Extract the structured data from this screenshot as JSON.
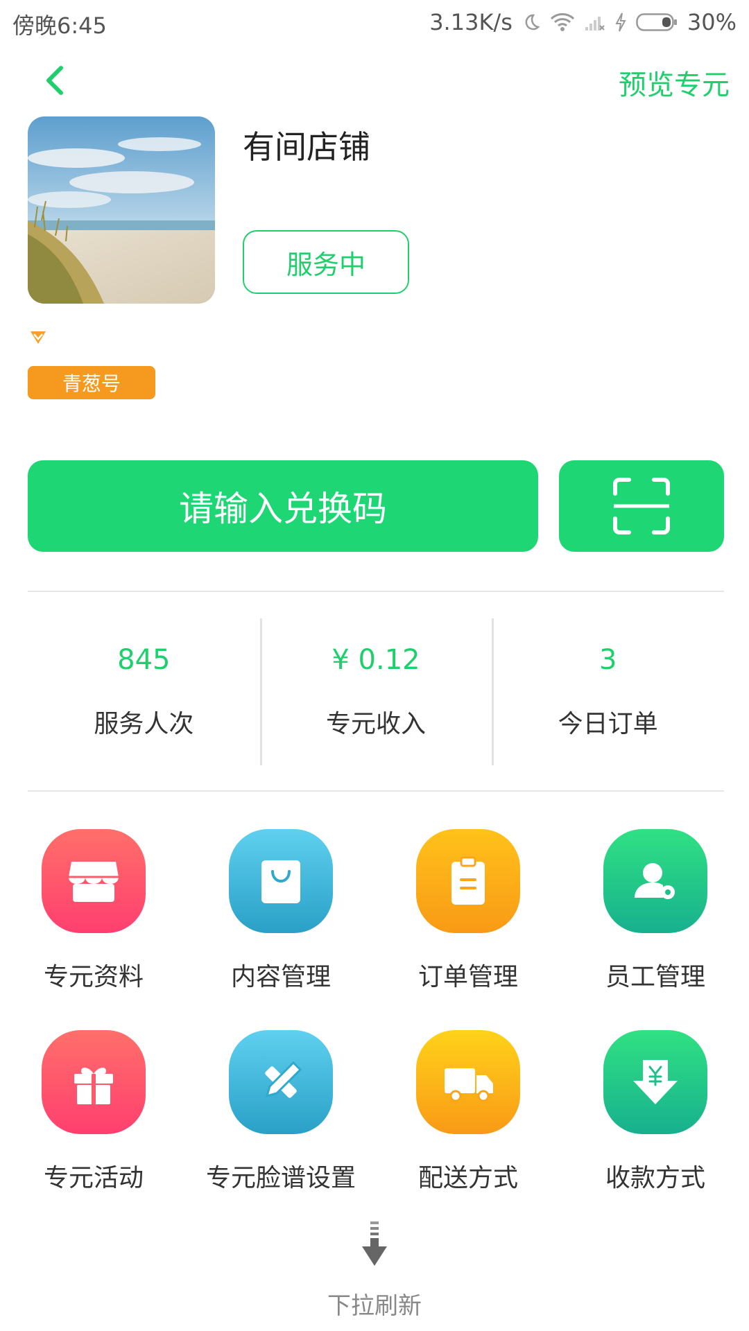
{
  "status_bar": {
    "time": "傍晚6:45",
    "speed": "3.13K/s",
    "battery": "30%"
  },
  "nav": {
    "preview_label": "预览专元"
  },
  "shop": {
    "name": "有间店铺",
    "status": "服务中",
    "tag": "青葱号"
  },
  "code_input": {
    "placeholder": "请输入兑换码"
  },
  "stats": [
    {
      "value": "845",
      "label": "服务人次"
    },
    {
      "value": "¥ 0.12",
      "label": "专元收入"
    },
    {
      "value": "3",
      "label": "今日订单"
    }
  ],
  "grid": [
    {
      "label": "专元资料",
      "icon": "shop-icon"
    },
    {
      "label": "内容管理",
      "icon": "shopping-bag-icon"
    },
    {
      "label": "订单管理",
      "icon": "clipboard-icon"
    },
    {
      "label": "员工管理",
      "icon": "user-settings-icon"
    },
    {
      "label": "专元活动",
      "icon": "gift-icon"
    },
    {
      "label": "专元脸谱设置",
      "icon": "pencil-ruler-icon"
    },
    {
      "label": "配送方式",
      "icon": "truck-icon"
    },
    {
      "label": "收款方式",
      "icon": "yen-download-icon"
    }
  ],
  "pull_refresh": {
    "label": "下拉刷新"
  },
  "colors": {
    "accent": "#1fcf6c",
    "button": "#1fd674",
    "tag": "#f59a1f"
  }
}
